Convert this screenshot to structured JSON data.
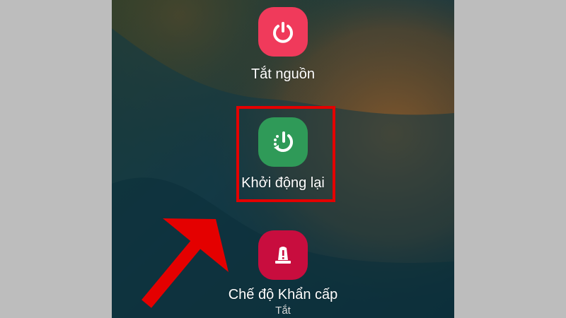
{
  "colors": {
    "page_background": "#bdbdbd",
    "power_icon_bg": "#f03a5b",
    "restart_icon_bg": "#2f9a58",
    "emergency_icon_bg": "#c80d3e",
    "highlight": "#e40000",
    "arrow": "#e40000"
  },
  "power_menu": {
    "items": [
      {
        "label": "Tắt nguồn",
        "icon": "power-icon"
      },
      {
        "label": "Khởi động lại",
        "icon": "restart-icon"
      },
      {
        "label": "Chế độ Khẩn cấp",
        "sublabel": "Tắt",
        "icon": "emergency-icon"
      }
    ]
  },
  "annotations": {
    "highlight_target": "Khởi động lại",
    "arrow": "red-arrow-pointing-to-restart"
  }
}
